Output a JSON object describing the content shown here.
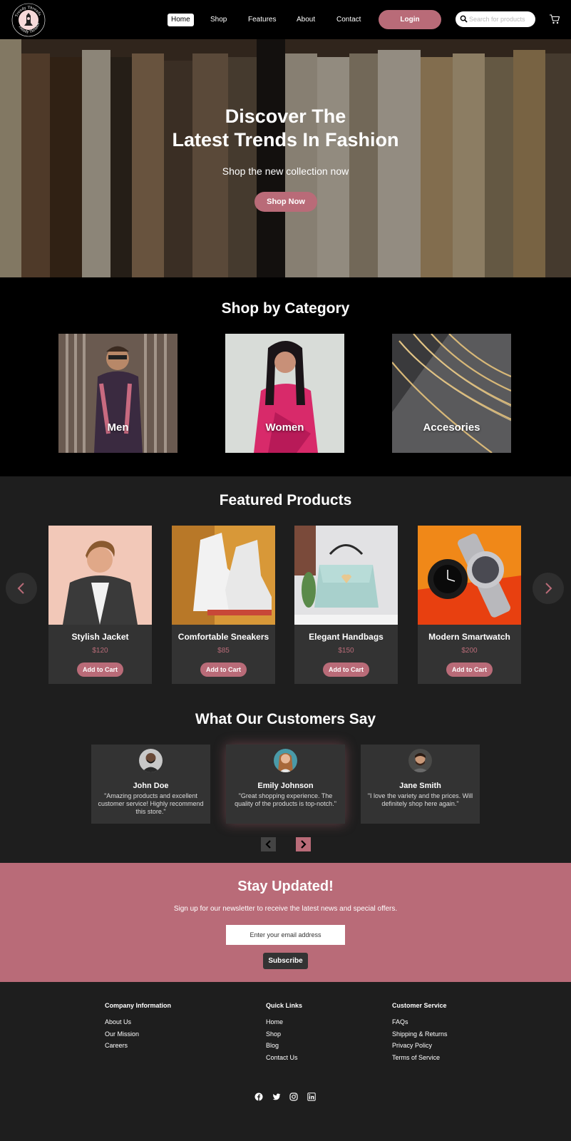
{
  "nav": {
    "logo_text": "Trendy Threads",
    "links": [
      "Home",
      "Shop",
      "Features",
      "About",
      "Contact"
    ],
    "active": "Home",
    "login_label": "Login",
    "search_placeholder": "Search for products",
    "icons": [
      "logo",
      "search-icon",
      "cart-icon"
    ]
  },
  "hero": {
    "title_line1": "Discover The",
    "title_line2": "Latest Trends In Fashion",
    "subtitle": "Shop the new collection now",
    "button": "Shop Now"
  },
  "categories": {
    "title": "Shop by Category",
    "items": [
      {
        "label": "Men"
      },
      {
        "label": "Women"
      },
      {
        "label": "Accesories"
      }
    ]
  },
  "featured": {
    "title": "Featured Products",
    "products": [
      {
        "name": "Stylish Jacket",
        "price": "$120",
        "button": "Add to Cart"
      },
      {
        "name": "Comfortable Sneakers",
        "price": "$85",
        "button": "Add to Cart"
      },
      {
        "name": "Elegant Handbags",
        "price": "$150",
        "button": "Add to Cart"
      },
      {
        "name": "Modern Smartwatch",
        "price": "$200",
        "button": "Add to Cart"
      }
    ]
  },
  "testimonials": {
    "title": "What Our Customers Say",
    "items": [
      {
        "name": "John Doe",
        "quote": "\"Amazing products and excellent customer service! Highly recommend this store.\""
      },
      {
        "name": "Emily Johnson",
        "quote": "\"Great shopping experience. The quality of the products is top-notch.\""
      },
      {
        "name": "Jane Smith",
        "quote": "\"I love the variety and the prices. Will definitely shop here again.\""
      }
    ]
  },
  "newsletter": {
    "title": "Stay Updated!",
    "subtitle": "Sign up for our newsletter to receive the latest news and special offers.",
    "placeholder": "Enter your email address",
    "button": "Subscribe"
  },
  "footer": {
    "columns": [
      {
        "heading": "Company Information",
        "links": [
          "About Us",
          "Our Mission",
          "Careers"
        ]
      },
      {
        "heading": "Quick Links",
        "links": [
          "Home",
          "Shop",
          "Blog",
          "Contact Us"
        ]
      },
      {
        "heading": "Customer Service",
        "links": [
          "FAQs",
          "Shipping & Returns",
          "Privacy Policy",
          "Terms of Service"
        ]
      }
    ],
    "social": [
      "facebook-icon",
      "twitter-icon",
      "instagram-icon",
      "linkedin-icon"
    ]
  },
  "colors": {
    "accent": "#b96b78",
    "dark_bg": "#1e1e1e",
    "card_bg": "#333333",
    "black": "#000000"
  }
}
